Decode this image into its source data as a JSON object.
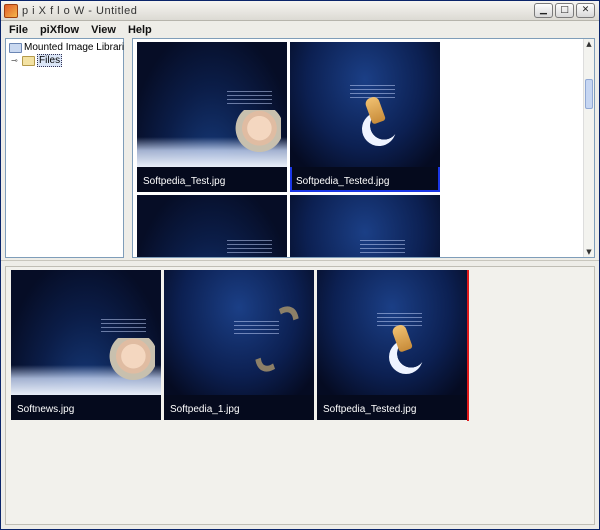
{
  "window": {
    "title": "p i X f l o W  -  Untitled",
    "controls": [
      "minimize-icon",
      "maximize-icon",
      "close-icon"
    ],
    "control_glyphs": [
      "▁",
      "□",
      "✕"
    ]
  },
  "menu": [
    {
      "label": "File"
    },
    {
      "label": "piXflow"
    },
    {
      "label": "View"
    },
    {
      "label": "Help"
    }
  ],
  "tree": {
    "root_label": "Mounted Image Libraries",
    "children": [
      {
        "label": "Files",
        "selected": true
      }
    ]
  },
  "library": {
    "thumbnails": [
      {
        "filename": "Softpedia_Test.jpg",
        "image": "portrait-woman",
        "selected": false
      },
      {
        "filename": "Softpedia_Tested.jpg",
        "image": "moon-figure",
        "selected": true
      },
      {
        "filename": "",
        "image": "dark-blue",
        "selected": false
      },
      {
        "filename": "",
        "image": "dark-blue",
        "selected": false
      }
    ]
  },
  "flow": {
    "thumbnails": [
      {
        "filename": "Softnews.jpg",
        "image": "portrait-woman"
      },
      {
        "filename": "Softpedia_1.jpg",
        "image": "s-shape"
      },
      {
        "filename": "Softpedia_Tested.jpg",
        "image": "moon-figure"
      }
    ],
    "insert_marker_color": "#e0191a"
  },
  "colors": {
    "selection": "#1a36e6",
    "thumb_bg": "#050a1d"
  }
}
